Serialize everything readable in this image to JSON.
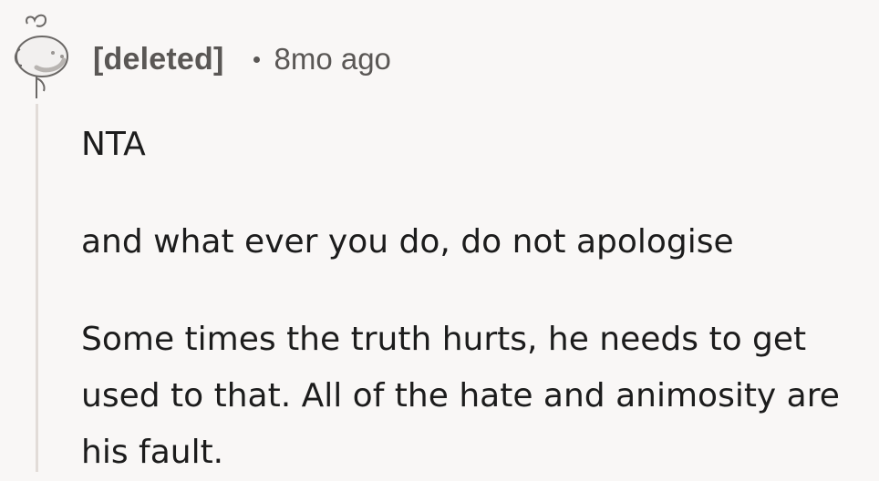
{
  "comment": {
    "author": "[deleted]",
    "timestamp": "8mo ago",
    "avatar_icon": "snoo-avatar-icon",
    "paragraphs": [
      "NTA",
      "and what ever you do, do not apologise",
      "Some times the truth hurts, he needs to get used to that. All of the hate and animosity are his fault."
    ]
  },
  "colors": {
    "background": "#f9f7f6",
    "meta_text": "#5a5755",
    "body_text": "#1c1c1c",
    "thread_line": "#e2dcd8"
  }
}
